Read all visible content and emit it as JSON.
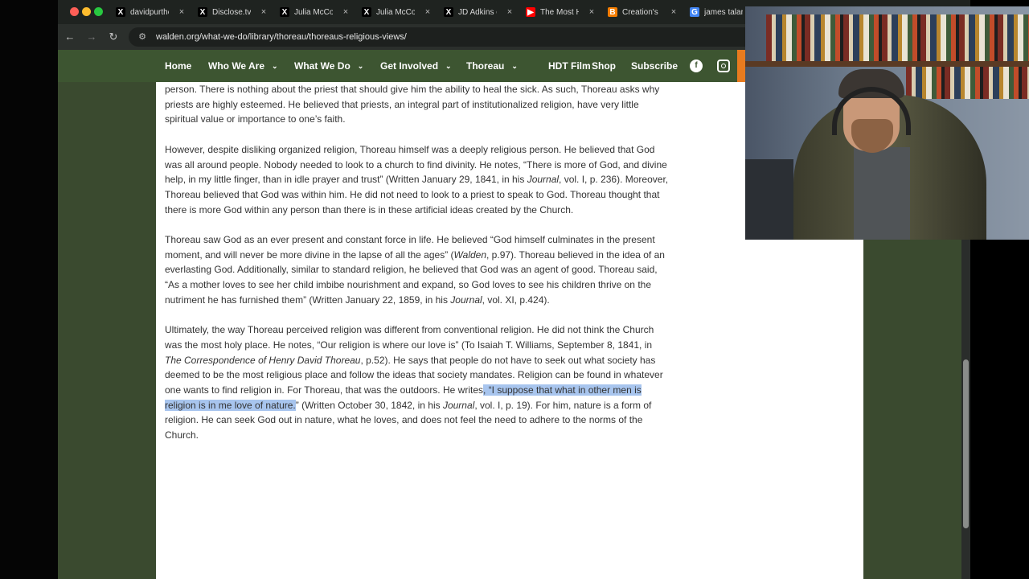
{
  "tabs": [
    {
      "title": "davidpurthe",
      "icon": "x-logo-icon",
      "icon_text": "X",
      "icon_color": "#000000"
    },
    {
      "title": "Disclose.tv",
      "icon": "x-logo-icon",
      "icon_text": "X",
      "icon_color": "#000000"
    },
    {
      "title": "Julia McCo",
      "icon": "x-logo-icon",
      "icon_text": "X",
      "icon_color": "#000000"
    },
    {
      "title": "Julia McCo",
      "icon": "x-logo-icon",
      "icon_text": "X",
      "icon_color": "#000000"
    },
    {
      "title": "JD Adkins o",
      "icon": "x-logo-icon",
      "icon_text": "X",
      "icon_color": "#000000"
    },
    {
      "title": "The Most H",
      "icon": "youtube-icon",
      "icon_text": "▶",
      "icon_color": "#ff0000"
    },
    {
      "title": "Creation's",
      "icon": "blogger-icon",
      "icon_text": "B",
      "icon_color": "#f57d00"
    },
    {
      "title": "james talari",
      "icon": "google-icon",
      "icon_text": "G",
      "icon_color": "#4285f4"
    }
  ],
  "address_bar": {
    "url": "walden.org/what-we-do/library/thoreau/thoreaus-religious-views/"
  },
  "site_nav": {
    "items": [
      {
        "label": "Home",
        "dropdown": false
      },
      {
        "label": "Who We Are",
        "dropdown": true
      },
      {
        "label": "What We Do",
        "dropdown": true
      },
      {
        "label": "Get Involved",
        "dropdown": true
      },
      {
        "label": "Thoreau",
        "dropdown": true
      },
      {
        "label": "HDT Film",
        "dropdown": false
      },
      {
        "label": "Shop",
        "dropdown": false
      },
      {
        "label": "Subscribe",
        "dropdown": false
      }
    ],
    "facebook_letter": "f"
  },
  "article": {
    "p1": "person. There is nothing about the priest that should give him the ability to heal the sick. As such, Thoreau asks why priests are highly esteemed. He believed that priests, an integral part of institutionalized religion, have very little spiritual value or importance to one’s faith.",
    "p2_a": "However, despite disliking organized religion, Thoreau himself was a deeply religious person. He believed that God was all around people. Nobody needed to look to a church to find divinity. He notes, “There is more of God, and divine help, in my little finger, than in idle prayer and trust” (Written January 29, 1841, in his ",
    "p2_journal": "Journal",
    "p2_b": ", vol. I, p. 236). Moreover, Thoreau believed that God was within him. He did not need to look to a priest to speak to God. Thoreau thought that there is more God within any person than there is in these artificial ideas created by the Church.",
    "p3_a": "Thoreau saw God as an ever present and constant force in life. He believed “God himself culminates in the present moment, and will never be more divine in the lapse of all the ages” (",
    "p3_walden": "Walden",
    "p3_b": ", p.97). Thoreau believed in the idea of an everlasting God. Additionally, similar to standard religion, he believed that God was an agent of good. Thoreau said, “As a mother loves to see her child imbibe nourishment and expand, so God loves to see his children thrive on the nutriment he has furnished them” (Written January 22, 1859, in his ",
    "p3_journal": "Journal",
    "p3_c": ", vol. XI, p.424).",
    "p4_a": "Ultimately, the way Thoreau perceived religion was different from conventional religion. He did not think the Church was the most holy place. He notes, “Our religion is where our love is” (To Isaiah T. Williams, September 8, 1841, in ",
    "p4_book": "The Correspondence of Henry David Thoreau",
    "p4_b": ", p.52). He says that people do not have to seek out what society has deemed to be the most religious place and follow the ideas that society mandates. Religion can be found in whatever one wants to find religion in. For Thoreau, that was the outdoors. He writes",
    "p4_highlight": ", “I suppose that what in other men is religion is in me love of nature.",
    "p4_c": "” (Written October 30, 1842, in his ",
    "p4_journal": "Journal",
    "p4_d": ", vol. I, p. 19). For him, nature is a form of religion. He can seek God out in nature, what he loves, and does not feel the need to adhere to the norms of the Church."
  },
  "colors": {
    "site_nav_green": "#3d5531",
    "page_background_green": "#3a4a2f",
    "accent_orange": "#e87b1f",
    "selection_highlight": "#a8c5ee"
  }
}
